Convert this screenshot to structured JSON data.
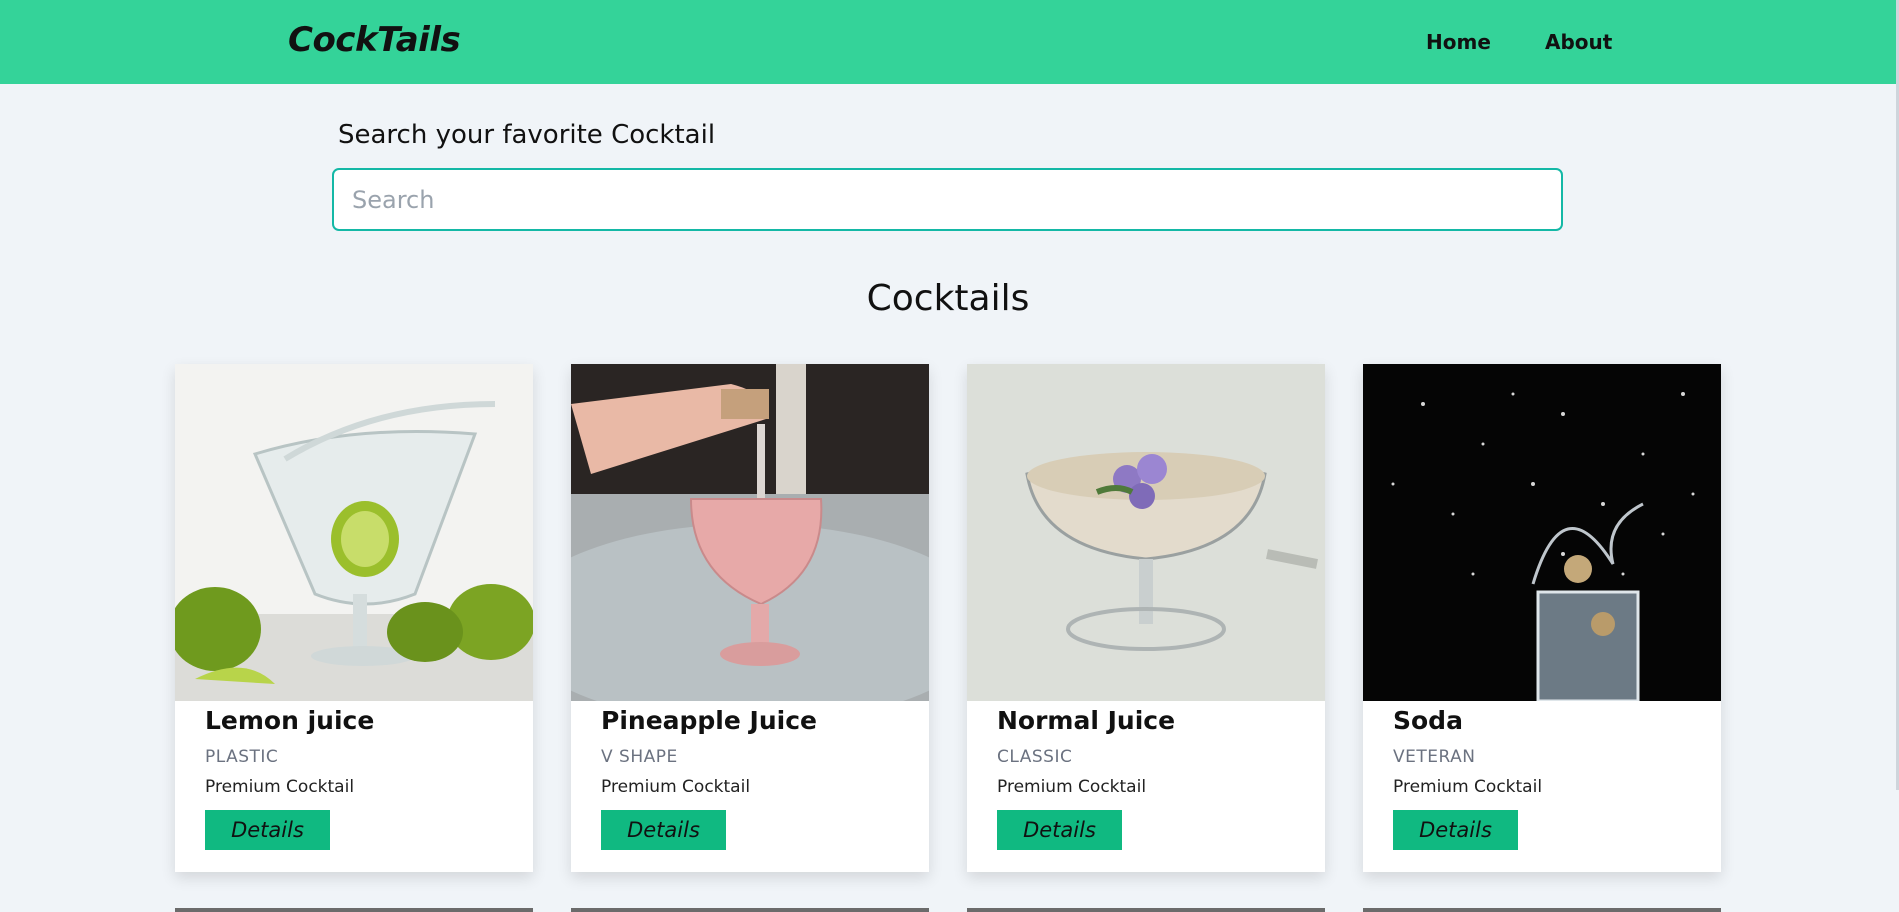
{
  "nav": {
    "brand": "CockTails",
    "links": [
      "Home",
      "About"
    ]
  },
  "search": {
    "label": "Search your favorite Cocktail",
    "placeholder": "Search",
    "value": ""
  },
  "section_title": "Cocktails",
  "colors": {
    "navbar": "#34d399",
    "accent_button": "#10b981",
    "input_border": "#14b8a6",
    "page_bg": "#f0f4f8"
  },
  "cocktails": [
    {
      "name": "Lemon juice",
      "glass": "PLASTIC",
      "info": "Premium Cocktail",
      "button": "Details"
    },
    {
      "name": "Pineapple Juice",
      "glass": "V SHAPE",
      "info": "Premium Cocktail",
      "button": "Details"
    },
    {
      "name": "Normal Juice",
      "glass": "CLASSIC",
      "info": "Premium Cocktail",
      "button": "Details"
    },
    {
      "name": "Soda",
      "glass": "VETERAN",
      "info": "Premium Cocktail",
      "button": "Details"
    }
  ]
}
